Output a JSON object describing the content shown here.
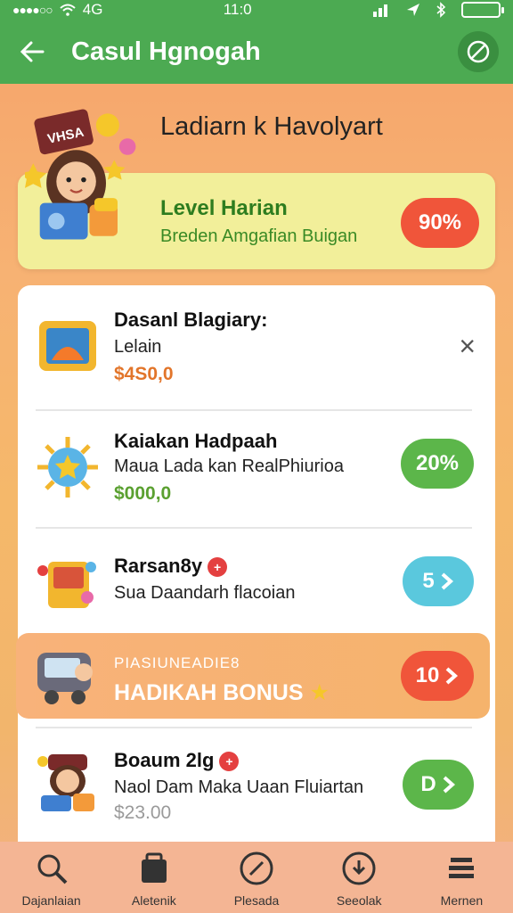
{
  "status": {
    "time": "11:0",
    "network": "4G"
  },
  "appbar": {
    "title": "Casul Hgnogah",
    "back_icon": "arrow-left-icon",
    "settings_icon": "circle-slash-icon"
  },
  "hero": {
    "heading": "Ladiarn k Havolyart",
    "badge_text": "VHSA"
  },
  "level": {
    "title": "Level Harian",
    "subtitle": "Breden Amgafian Buigan",
    "percent": "90%"
  },
  "items": [
    {
      "name": "Dasanl Blagiary:",
      "desc": "Lelain",
      "price": "$4S0,0",
      "action": "×"
    },
    {
      "name": "Kaiakan Hadpaah",
      "desc": "Maua Lada kan RealPhiurioa",
      "price": "$000,0",
      "action": "20%"
    },
    {
      "name": "Rarsan8y",
      "desc": "Sua Daandarh flacoian",
      "price": "",
      "action": "5"
    }
  ],
  "bonus": {
    "subtitle": "PIASIUNEADIE8",
    "title": "HADIKAH BONUS",
    "action": "10"
  },
  "last_item": {
    "name": "Boaum 2lg",
    "desc": "Naol Dam Maka Uaan Fluiartan",
    "price": "$23.00",
    "action": "D"
  },
  "nav": [
    {
      "label": "Dajanlaian",
      "icon": "search-icon"
    },
    {
      "label": "Aletenik",
      "icon": "shop-icon"
    },
    {
      "label": "Plesada",
      "icon": "edit-circle-icon"
    },
    {
      "label": "Seeolak",
      "icon": "download-circle-icon"
    },
    {
      "label": "Mernen",
      "icon": "menu-icon"
    }
  ],
  "colors": {
    "green": "#4caa52",
    "accent_red": "#f0553a",
    "progress_green": "#5cb64a",
    "teal": "#5ac8dd"
  }
}
